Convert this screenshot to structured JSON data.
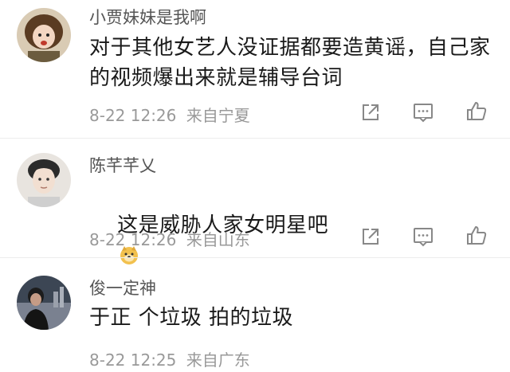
{
  "comments": [
    {
      "username": "小贾妹妹是我啊",
      "text": "对于其他女艺人没证据都要造黄谣，自己家的视频爆出来就是辅导台词",
      "time": "8-22 12:26",
      "location": "来自宁夏",
      "emoji": ""
    },
    {
      "username": "陈芊芊乂",
      "text": "这是威胁人家女明星吧",
      "time": "8-22 12:26",
      "location": "来自山东",
      "emoji": "doge-emoji"
    },
    {
      "username": "俊一定神",
      "text": "于正 个垃圾 拍的垃圾",
      "time": "8-22 12:25",
      "location": "来自广东",
      "emoji": ""
    }
  ],
  "icons": {
    "share": "share-icon",
    "comment": "comment-icon",
    "like": "thumbs-up-icon"
  },
  "colors": {
    "username": "#555555",
    "meta": "#999999",
    "content": "#1a1a1a",
    "icon": "#888888"
  }
}
